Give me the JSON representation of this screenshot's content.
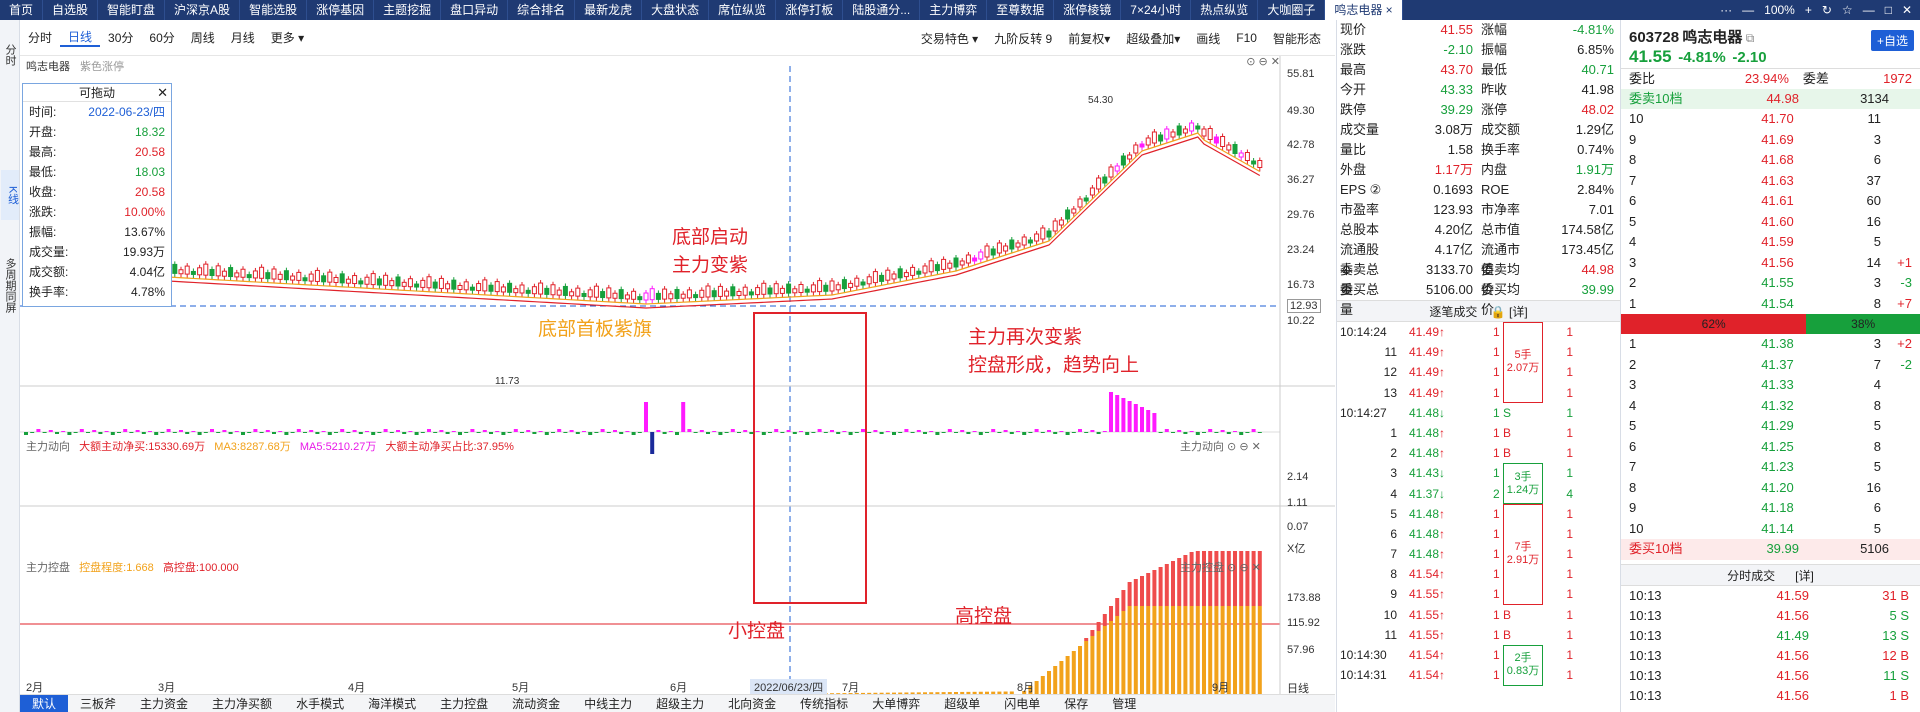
{
  "tabs": [
    "首页",
    "自选股",
    "智能盯盘",
    "沪深京A股",
    "智能选股",
    "涨停基因",
    "主题挖掘",
    "盘口异动",
    "综合排名",
    "最新龙虎",
    "大盘状态",
    "席位纵览",
    "涨停打板",
    "陆股通分...",
    "主力博弈",
    "至尊数据",
    "涨停棱镜",
    "7×24小时",
    "热点纵览",
    "大咖圈子",
    "鸣志电器 ×"
  ],
  "window_controls": [
    "···",
    "—",
    "100%",
    "+",
    "↻",
    "☆",
    "—",
    "□",
    "✕"
  ],
  "sidebar": [
    "分时",
    "K线",
    "多周期同屏"
  ],
  "toolbar": {
    "left": [
      "分时",
      "日线",
      "30分",
      "60分",
      "周线",
      "月线",
      "更多 ▾"
    ],
    "right": [
      "交易特色 ▾",
      "九阶反转 9",
      "前复权▾",
      "超级叠加▾",
      "画线",
      "F10",
      "智能形态"
    ]
  },
  "stock_label": "鸣志电器",
  "mode_label": "紫色涨停",
  "tooltip": {
    "title": "可拖动",
    "rows": [
      [
        "时间:",
        "2022-06-23/四",
        "b"
      ],
      [
        "开盘:",
        "18.32",
        "g"
      ],
      [
        "最高:",
        "20.58",
        "r"
      ],
      [
        "最低:",
        "18.03",
        "g"
      ],
      [
        "收盘:",
        "20.58",
        "r"
      ],
      [
        "涨跌:",
        "10.00%",
        "r"
      ],
      [
        "振幅:",
        "13.67%",
        "k"
      ],
      [
        "成交量:",
        "19.93万",
        "k"
      ],
      [
        "成交额:",
        "4.04亿",
        "k"
      ],
      [
        "换手率:",
        "4.78%",
        "k"
      ]
    ]
  },
  "price_axis": [
    "55.81",
    "49.30",
    "42.78",
    "36.27",
    "29.76",
    "23.24",
    "16.73",
    "12.93",
    "10.22"
  ],
  "flow_axis": [
    "2.14",
    "1.11",
    "0.07",
    "X亿"
  ],
  "ctrl_axis": [
    "173.88",
    "115.92",
    "57.96"
  ],
  "date_labels": [
    "2月",
    "3月",
    "4月",
    "5月",
    "6月",
    "2022/06/23/四",
    "7月",
    "8月",
    "9月"
  ],
  "peak_label": "54.30",
  "low_label": "11.73",
  "flow_header": {
    "name": "主力动向",
    "items": [
      "大额主动净买:15330.69万",
      "MA3:8287.68万",
      "MA5:5210.27万",
      "大额主动净买占比:37.95%"
    ],
    "right": "主力动向"
  },
  "ctrl_header": {
    "name": "主力控盘",
    "items": [
      "控盘程度:1.668",
      "高控盘:100.000"
    ],
    "right": "主力控盘"
  },
  "annotations": {
    "a1": "底部启动",
    "a2": "主力变紫",
    "a3": "底部首板紫旗",
    "a4": "主力再次变紫",
    "a5": "控盘形成，趋势向上",
    "a6": "小控盘",
    "a7": "高控盘"
  },
  "bottom_tabs": [
    "默认",
    "三板斧",
    "主力资金",
    "主力净买额",
    "水手模式",
    "海洋模式",
    "主力控盘",
    "流动资金",
    "中线主力",
    "超级主力",
    "北向资金",
    "传统指标",
    "大单博弈",
    "超级单",
    "闪电单",
    "保存",
    "管理"
  ],
  "right_axis_label": "日线",
  "quote": [
    [
      "现价",
      "41.55",
      "r",
      "涨幅",
      "-4.81%",
      "g"
    ],
    [
      "涨跌",
      "-2.10",
      "g",
      "振幅",
      "6.85%",
      "k"
    ],
    [
      "最高",
      "43.70",
      "r",
      "最低",
      "40.71",
      "g"
    ],
    [
      "今开",
      "43.33",
      "g",
      "昨收",
      "41.98",
      "k"
    ],
    [
      "跌停",
      "39.29",
      "g",
      "涨停",
      "48.02",
      "r"
    ],
    [
      "成交量",
      "3.08万",
      "k",
      "成交额",
      "1.29亿",
      "k"
    ],
    [
      "量比",
      "1.58",
      "k",
      "换手率",
      "0.74%",
      "k"
    ],
    [
      "外盘",
      "1.17万",
      "r",
      "内盘",
      "1.91万",
      "g"
    ],
    [
      "EPS ②",
      "0.1693",
      "k",
      "ROE",
      "2.84%",
      "k"
    ],
    [
      "市盈率",
      "123.93",
      "k",
      "市净率",
      "7.01",
      "k"
    ],
    [
      "总股本",
      "4.20亿",
      "k",
      "总市值",
      "174.58亿",
      "k"
    ],
    [
      "流通股本",
      "4.17亿",
      "k",
      "流通市值",
      "173.45亿",
      "k"
    ],
    [
      "委卖总量",
      "3133.70",
      "k",
      "委卖均价",
      "44.98",
      "r"
    ],
    [
      "委买总量",
      "5106.00",
      "k",
      "委买均价",
      "39.99",
      "g"
    ]
  ],
  "trades_title": "逐笔成交",
  "trades_detail": "[详]",
  "trades": [
    [
      "10:14:24",
      "41.49",
      "1 B",
      "1"
    ],
    [
      "11",
      "41.49",
      "1 B",
      "1"
    ],
    [
      "12",
      "41.49",
      "1 B",
      "1"
    ],
    [
      "13",
      "41.49",
      "1 B",
      "1"
    ],
    [
      "10:14:27",
      "41.48",
      "1 S",
      "1"
    ],
    [
      "1",
      "41.48",
      "1 B",
      "1"
    ],
    [
      "2",
      "41.48",
      "1 B",
      "1"
    ],
    [
      "3",
      "41.43",
      "1 S",
      "1"
    ],
    [
      "4",
      "41.37",
      "2 S",
      "4"
    ],
    [
      "5",
      "41.48",
      "1 B",
      "1"
    ],
    [
      "6",
      "41.48",
      "1 B",
      "1"
    ],
    [
      "7",
      "41.48",
      "1 B",
      "1"
    ],
    [
      "8",
      "41.54",
      "1 B",
      "1"
    ],
    [
      "9",
      "41.55",
      "1 B",
      "1"
    ],
    [
      "10",
      "41.55",
      "1 B",
      "1"
    ],
    [
      "11",
      "41.55",
      "1 B",
      "1"
    ],
    [
      "10:14:30",
      "41.54",
      "1 B",
      "1"
    ],
    [
      "10:14:31",
      "41.54",
      "1 B",
      "1"
    ]
  ],
  "trade_boxes": [
    "5手",
    "2.07万",
    "3手",
    "1.24万",
    "7手",
    "2.91万",
    "2手",
    "0.83万"
  ],
  "depth": {
    "code": "603728",
    "name": "鸣志电器",
    "price": "41.55",
    "chg": "-4.81%",
    "chg_abs": "-2.10",
    "add": "+自选",
    "wb": [
      "委比",
      "23.94%",
      "委差",
      "1972"
    ],
    "sell_hdr": [
      "委卖10档",
      "44.98",
      "3134"
    ],
    "asks": [
      [
        "10",
        "41.70",
        "11",
        ""
      ],
      [
        "9",
        "41.69",
        "3",
        ""
      ],
      [
        "8",
        "41.68",
        "6",
        ""
      ],
      [
        "7",
        "41.63",
        "37",
        ""
      ],
      [
        "6",
        "41.61",
        "60",
        ""
      ],
      [
        "5",
        "41.60",
        "16",
        ""
      ],
      [
        "4",
        "41.59",
        "5",
        ""
      ],
      [
        "3",
        "41.56",
        "14",
        "+1"
      ],
      [
        "2",
        "41.55",
        "3",
        "-3"
      ],
      [
        "1",
        "41.54",
        "8",
        "+7"
      ]
    ],
    "ratio": [
      "62%",
      "38%"
    ],
    "bids": [
      [
        "1",
        "41.38",
        "3",
        "+2"
      ],
      [
        "2",
        "41.37",
        "7",
        "-2"
      ],
      [
        "3",
        "41.33",
        "4",
        ""
      ],
      [
        "4",
        "41.32",
        "8",
        ""
      ],
      [
        "5",
        "41.29",
        "5",
        ""
      ],
      [
        "6",
        "41.25",
        "8",
        ""
      ],
      [
        "7",
        "41.23",
        "5",
        ""
      ],
      [
        "8",
        "41.20",
        "16",
        ""
      ],
      [
        "9",
        "41.18",
        "6",
        ""
      ],
      [
        "10",
        "41.14",
        "5",
        ""
      ]
    ],
    "buy_hdr": [
      "委买10档",
      "39.99",
      "5106"
    ],
    "ticks_title": "分时成交",
    "ticks_detail": "[详]",
    "ticks": [
      [
        "10:13",
        "41.59",
        "31 B"
      ],
      [
        "10:13",
        "41.56",
        "5 S"
      ],
      [
        "10:13",
        "41.49",
        "13 S"
      ],
      [
        "10:13",
        "41.56",
        "12 B"
      ],
      [
        "10:13",
        "41.56",
        "11 S"
      ],
      [
        "10:13",
        "41.56",
        "1 B"
      ]
    ]
  }
}
